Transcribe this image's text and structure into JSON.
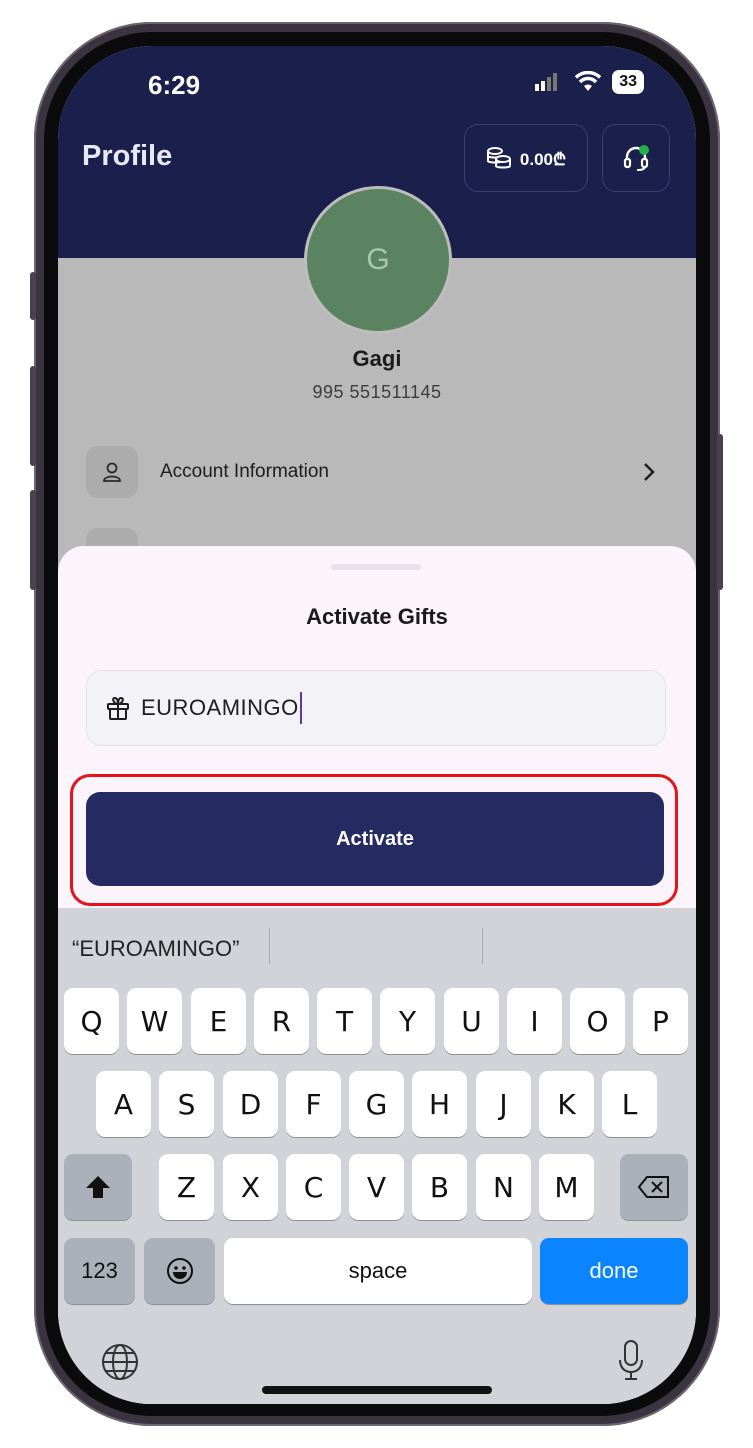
{
  "status_bar": {
    "time": "6:29",
    "battery": "33"
  },
  "header": {
    "title": "Profile",
    "balance": "0.00₾"
  },
  "profile": {
    "avatar_initial": "G",
    "name": "Gagi",
    "phone": "995 551511145"
  },
  "menu": {
    "items": [
      {
        "label": "Account Information",
        "icon": "person-icon"
      }
    ]
  },
  "sheet": {
    "title": "Activate Gifts",
    "gift_code_value": "EUROAMINGO",
    "activate_label": "Activate"
  },
  "keyboard": {
    "suggestion": "“EUROAMINGO”",
    "row1": [
      "Q",
      "W",
      "E",
      "R",
      "T",
      "Y",
      "U",
      "I",
      "O",
      "P"
    ],
    "row2": [
      "A",
      "S",
      "D",
      "F",
      "G",
      "H",
      "J",
      "K",
      "L"
    ],
    "row3": [
      "Z",
      "X",
      "C",
      "V",
      "B",
      "N",
      "M"
    ],
    "numbers_label": "123",
    "space_label": "space",
    "done_label": "done"
  },
  "colors": {
    "header": "#1b1f4c",
    "button": "#252a62",
    "highlight": "#e8131a",
    "done": "#0a84ff"
  }
}
